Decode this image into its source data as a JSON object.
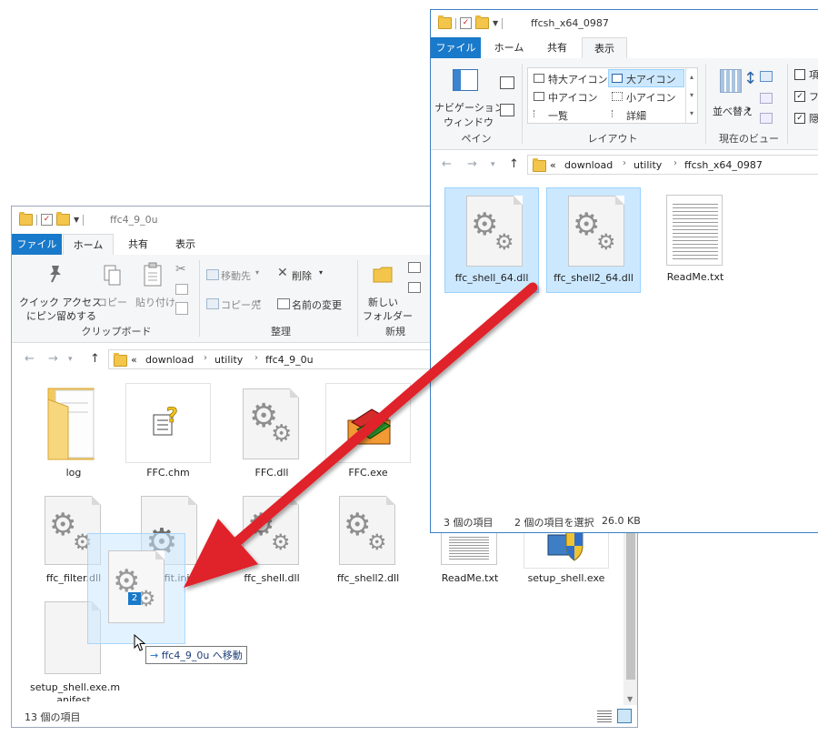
{
  "left_window": {
    "title": "ffc4_9_0u",
    "tabs": [
      "ファイル",
      "ホーム",
      "共有",
      "表示"
    ],
    "ribbon": {
      "pin_label_1": "クイック アクセス",
      "pin_label_2": "にピン留めする",
      "copy": "コピー",
      "paste": "貼り付け",
      "clipboard_group": "クリップボード",
      "move_to": "移動先",
      "copy_to": "コピー先",
      "delete": "削除",
      "rename": "名前の変更",
      "organize_group": "整理",
      "new_folder_1": "新しい",
      "new_folder_2": "フォルダー",
      "new_group": "新規"
    },
    "address": [
      "«",
      "download",
      "utility",
      "ffc4_9_0u"
    ],
    "files": [
      "log",
      "FFC.chm",
      "FFC.dll",
      "FFC.exe",
      "ffc_filter.dll",
      "ffc_fit.ini",
      "ffc_shell.dll",
      "ffc_shell2.dll",
      "ReadMe.txt",
      "setup_shell.exe",
      "setup_shell.exe.m",
      "anifest"
    ],
    "status": "13 個の項目",
    "drag_count": "2",
    "drag_tooltip": "ffc4_9_0u へ移動",
    "drag_arrow": "→"
  },
  "right_window": {
    "title": "ffcsh_x64_0987",
    "tabs": [
      "ファイル",
      "ホーム",
      "共有",
      "表示"
    ],
    "ribbon": {
      "nav_pane_1": "ナビゲーション",
      "nav_pane_2": "ウィンドウ",
      "pane_group": "ペイン",
      "layouts": [
        "特大アイコン",
        "大アイコン",
        "中アイコン",
        "小アイコン",
        "一覧",
        "詳細"
      ],
      "layout_group": "レイアウト",
      "sort_by": "並べ替え",
      "view_group": "現在のビュー",
      "checkbox_partial_1": "項",
      "checkbox_partial_2": "フ",
      "checkbox_partial_3": "隠"
    },
    "address": [
      "«",
      "download",
      "utility",
      "ffcsh_x64_0987"
    ],
    "files": [
      "ffc_shell_64.dll",
      "ffc_shell2_64.dll",
      "ReadMe.txt"
    ],
    "status_count": "3 個の項目",
    "status_selected": "2 個の項目を選択",
    "status_size": "26.0 KB"
  },
  "colors": {
    "accent": "#1979ca",
    "selection": "#cce8ff",
    "arrow": "#e0242a"
  }
}
